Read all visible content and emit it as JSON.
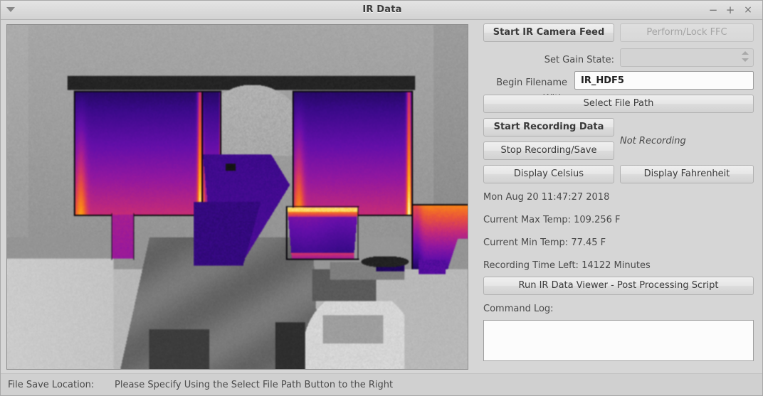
{
  "window": {
    "title": "IR Data",
    "menu_icon": "caret-down-icon",
    "minimize_label": "−",
    "maximize_label": "+",
    "close_label": "×"
  },
  "ir_view": {
    "name": "ir-camera-image",
    "description": "Thermal infrared camera frame: grayscale room with person in profile; hot regions rendered in inferno colormap (purple/magenta/orange) on a monitor, a cup and a mug."
  },
  "controls": {
    "start_feed": "Start IR Camera Feed",
    "perform_ffc": "Perform/Lock FFC",
    "gain_label": "Set Gain State:",
    "gain_value": "",
    "filename_label": "Begin Filename With:",
    "filename_value": "IR_HDF5",
    "filename_placeholder": "",
    "select_file_path": "Select File Path",
    "start_recording": "Start Recording Data",
    "stop_recording": "Stop Recording/Save",
    "recording_status": "Not Recording",
    "display_celsius": "Display Celsius",
    "display_fahrenheit": "Display Fahrenheit",
    "datetime": "Mon Aug 20 11:47:27 2018",
    "max_temp": "Current Max Temp: 109.256 F",
    "min_temp": "Current Min Temp: 77.45 F",
    "time_left": "Recording Time Left: 14122 Minutes",
    "run_viewer": "Run IR Data Viewer - Post Processing Script",
    "command_log_label": "Command Log:",
    "command_log_value": ""
  },
  "statusbar": {
    "label": "File Save Location:",
    "value": "Please Specify Using the Select File Path Button to the Right"
  },
  "colors": {
    "window_bg": "#d6d6d6",
    "titlebar_bg": "#dcdcdc",
    "button_face": "#e6e6e6",
    "text": "#4a4a4a",
    "field_bg": "#fcfcfc"
  }
}
